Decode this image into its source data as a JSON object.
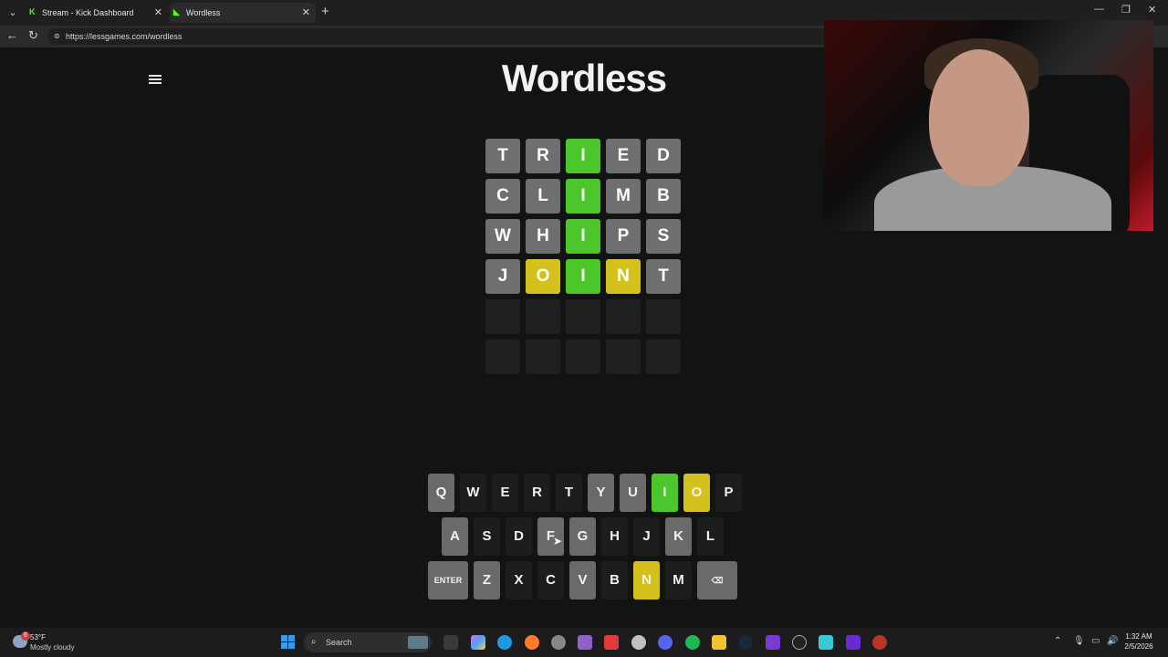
{
  "browser": {
    "tabs": [
      {
        "title": "Stream - Kick Dashboard",
        "favicon": "K"
      },
      {
        "title": "Wordless",
        "favicon": "L"
      }
    ],
    "new_tab": "+",
    "address": "https://lessgames.com/wordless"
  },
  "game": {
    "title": "Wordless",
    "board": [
      [
        {
          "l": "T",
          "s": "absent"
        },
        {
          "l": "R",
          "s": "absent"
        },
        {
          "l": "I",
          "s": "correct"
        },
        {
          "l": "E",
          "s": "absent"
        },
        {
          "l": "D",
          "s": "absent"
        }
      ],
      [
        {
          "l": "C",
          "s": "absent"
        },
        {
          "l": "L",
          "s": "absent"
        },
        {
          "l": "I",
          "s": "correct"
        },
        {
          "l": "M",
          "s": "absent"
        },
        {
          "l": "B",
          "s": "absent"
        }
      ],
      [
        {
          "l": "W",
          "s": "absent"
        },
        {
          "l": "H",
          "s": "absent"
        },
        {
          "l": "I",
          "s": "correct"
        },
        {
          "l": "P",
          "s": "absent"
        },
        {
          "l": "S",
          "s": "absent"
        }
      ],
      [
        {
          "l": "J",
          "s": "absent"
        },
        {
          "l": "O",
          "s": "present"
        },
        {
          "l": "I",
          "s": "correct"
        },
        {
          "l": "N",
          "s": "present"
        },
        {
          "l": "T",
          "s": "absent"
        }
      ],
      [
        {
          "l": "",
          "s": "empty"
        },
        {
          "l": "",
          "s": "empty"
        },
        {
          "l": "",
          "s": "empty"
        },
        {
          "l": "",
          "s": "empty"
        },
        {
          "l": "",
          "s": "empty"
        }
      ],
      [
        {
          "l": "",
          "s": "empty"
        },
        {
          "l": "",
          "s": "empty"
        },
        {
          "l": "",
          "s": "empty"
        },
        {
          "l": "",
          "s": "empty"
        },
        {
          "l": "",
          "s": "empty"
        }
      ]
    ],
    "keyboard": [
      [
        {
          "k": "Q",
          "s": "absent"
        },
        {
          "k": "W",
          "s": "dark"
        },
        {
          "k": "E",
          "s": "dark"
        },
        {
          "k": "R",
          "s": "dark"
        },
        {
          "k": "T",
          "s": "dark"
        },
        {
          "k": "Y",
          "s": "absent"
        },
        {
          "k": "U",
          "s": "absent"
        },
        {
          "k": "I",
          "s": "correct"
        },
        {
          "k": "O",
          "s": "present"
        },
        {
          "k": "P",
          "s": "dark"
        }
      ],
      [
        {
          "k": "A",
          "s": "absent"
        },
        {
          "k": "S",
          "s": "dark"
        },
        {
          "k": "D",
          "s": "dark"
        },
        {
          "k": "F",
          "s": "absent"
        },
        {
          "k": "G",
          "s": "absent"
        },
        {
          "k": "H",
          "s": "dark"
        },
        {
          "k": "J",
          "s": "dark"
        },
        {
          "k": "K",
          "s": "absent"
        },
        {
          "k": "L",
          "s": "dark"
        }
      ],
      [
        {
          "k": "ENTER",
          "s": "absent",
          "wide": true
        },
        {
          "k": "Z",
          "s": "absent"
        },
        {
          "k": "X",
          "s": "dark"
        },
        {
          "k": "C",
          "s": "dark"
        },
        {
          "k": "V",
          "s": "absent"
        },
        {
          "k": "B",
          "s": "dark"
        },
        {
          "k": "N",
          "s": "present"
        },
        {
          "k": "M",
          "s": "dark"
        },
        {
          "k": "⌫",
          "s": "absent",
          "wide": true,
          "name": "backspace-icon"
        }
      ]
    ],
    "colors": {
      "correct": "#4cc72b",
      "present": "#d4c11c",
      "absent": "#6f6f6f",
      "empty": "#1f2020"
    }
  },
  "taskbar": {
    "weather_temp": "53°F",
    "weather_desc": "Mostly cloudy",
    "weather_badge": "6",
    "search_placeholder": "Search",
    "time": "1:32 AM",
    "date": "2/5/2026"
  }
}
